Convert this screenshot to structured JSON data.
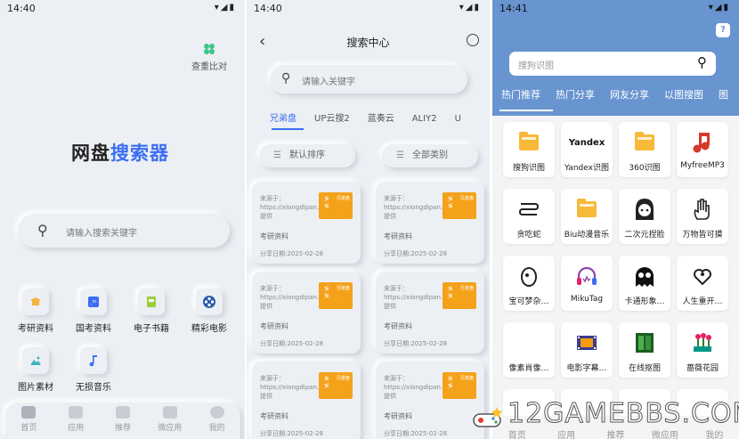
{
  "screen1": {
    "status": {
      "time": "14:40"
    },
    "compare_label": "查重比对",
    "logo": {
      "part1": "网盘",
      "part2": "搜索器"
    },
    "search_placeholder": "请输入搜索关键字",
    "tiles": [
      {
        "label": "考研资料",
        "icon": "graduation-cap-icon",
        "color": "#f5b43b"
      },
      {
        "label": "国考资料",
        "icon": "document-badge-icon",
        "color": "#3b6ef2"
      },
      {
        "label": "电子书籍",
        "icon": "book-icon",
        "color": "#9ad03b"
      },
      {
        "label": "精彩电影",
        "icon": "film-reel-icon",
        "color": "#2a5db0"
      },
      {
        "label": "图片素材",
        "icon": "landscape-image-icon",
        "color": "#3bb3c2"
      },
      {
        "label": "无损音乐",
        "icon": "music-note-icon",
        "color": "#3b6ef2"
      }
    ],
    "tabbar": [
      "首页",
      "应用",
      "推荐",
      "微应用",
      "我的"
    ]
  },
  "screen2": {
    "status": {
      "time": "14:40"
    },
    "title": "搜索中心",
    "search_placeholder": "请输入关键字",
    "tabs": [
      "兄弟盘",
      "UP云搜2",
      "蓝奏云",
      "ALIY2",
      "U"
    ],
    "filters": [
      "默认排序",
      "全部类别"
    ],
    "card": {
      "source": "来源于：https://xiongdipan.com/提供",
      "thumb_tag": "兄弟盘",
      "title": "考研资料",
      "date": "分享日期:2025-02-28"
    },
    "card_count": 6
  },
  "screen3": {
    "status": {
      "time": "14:41"
    },
    "search_placeholder": "搜狗识图",
    "tabs": [
      "热门推荐",
      "热门分享",
      "网友分享",
      "以图搜图",
      "图"
    ],
    "grid": [
      {
        "label": "搜狗识图",
        "icon": "folder-icon"
      },
      {
        "label": "Yandex识图",
        "icon": "yandex-text-icon",
        "text": "Yandex"
      },
      {
        "label": "360识图",
        "icon": "folder-icon"
      },
      {
        "label": "MyfreeMP3",
        "icon": "music-note-icon"
      },
      {
        "label": "贪吃蛇",
        "icon": "snake-icon"
      },
      {
        "label": "Biu动漫音乐",
        "icon": "folder-icon"
      },
      {
        "label": "二次元捏脸",
        "icon": "anime-face-icon"
      },
      {
        "label": "万物皆可摸",
        "icon": "hand-icon"
      },
      {
        "label": "宝可梦杂…",
        "icon": "egg-icon"
      },
      {
        "label": "MikuTag",
        "icon": "headphones-icon"
      },
      {
        "label": "卡通形象…",
        "icon": "ghost-icon"
      },
      {
        "label": "人生重开…",
        "icon": "heart-person-icon"
      },
      {
        "label": "像素肖像…",
        "icon": "blank-icon"
      },
      {
        "label": "电影字幕…",
        "icon": "film-strip-icon"
      },
      {
        "label": "在线抠图",
        "icon": "film-green-icon"
      },
      {
        "label": "蔷薇花园",
        "icon": "garden-icon"
      }
    ],
    "tabbar": [
      "首页",
      "应用",
      "推荐",
      "微应用",
      "我的"
    ]
  },
  "watermark": "12GAMEBBS.COM"
}
